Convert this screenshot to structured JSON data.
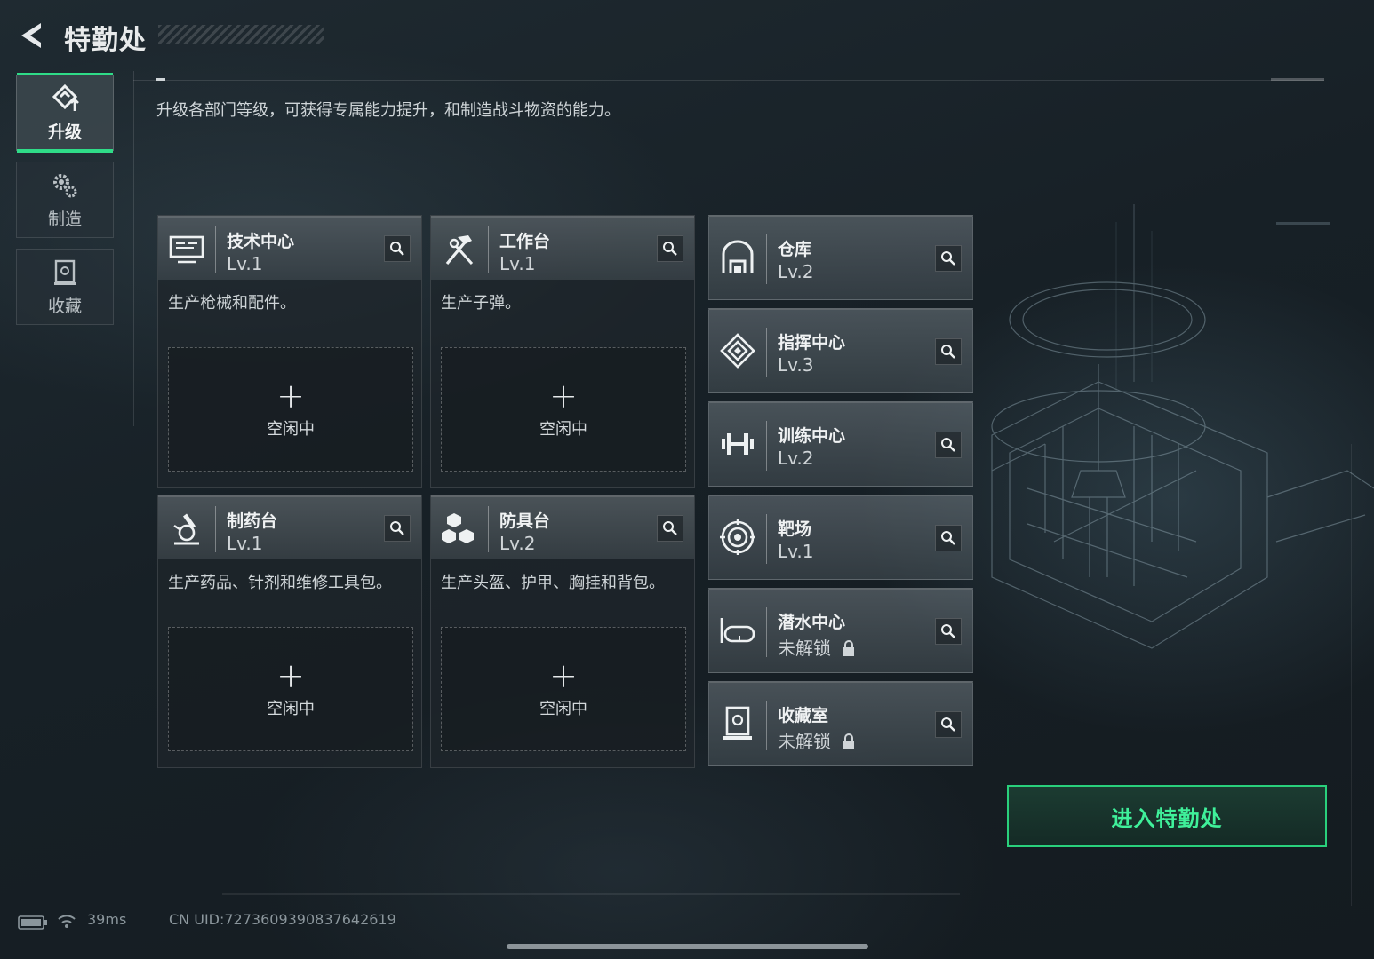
{
  "header": {
    "title": "特勤处"
  },
  "sidebar": {
    "tabs": [
      {
        "label": "升级",
        "icon": "upgrade-icon",
        "active": true
      },
      {
        "label": "制造",
        "icon": "gears-icon",
        "active": false
      },
      {
        "label": "收藏",
        "icon": "collection-icon",
        "active": false
      }
    ]
  },
  "main": {
    "description": "升级各部门等级，可获得专属能力提升，和制造战斗物资的能力。",
    "production_cards": [
      {
        "name": "技术中心",
        "level": "Lv.1",
        "desc": "生产枪械和配件。",
        "slot_label": "空闲中",
        "icon": "monitor-icon"
      },
      {
        "name": "工作台",
        "level": "Lv.1",
        "desc": "生产子弹。",
        "slot_label": "空闲中",
        "icon": "hammer-wrench-icon"
      },
      {
        "name": "制药台",
        "level": "Lv.1",
        "desc": "生产药品、针剂和维修工具包。",
        "slot_label": "空闲中",
        "icon": "microscope-icon"
      },
      {
        "name": "防具台",
        "level": "Lv.2",
        "desc": "生产头盔、护甲、胸挂和背包。",
        "slot_label": "空闲中",
        "icon": "cubes-icon"
      }
    ],
    "facilities": [
      {
        "name": "仓库",
        "level": "Lv.2",
        "icon": "warehouse-icon",
        "locked": false
      },
      {
        "name": "指挥中心",
        "level": "Lv.3",
        "icon": "chip-icon",
        "locked": false
      },
      {
        "name": "训练中心",
        "level": "Lv.2",
        "icon": "dumbbell-icon",
        "locked": false
      },
      {
        "name": "靶场",
        "level": "Lv.1",
        "icon": "target-icon",
        "locked": false
      },
      {
        "name": "潜水中心",
        "level": "未解锁",
        "icon": "diving-mask-icon",
        "locked": true
      },
      {
        "name": "收藏室",
        "level": "未解锁",
        "icon": "display-case-icon",
        "locked": true
      }
    ]
  },
  "enter_button": {
    "label": "进入特勤处"
  },
  "status_bar": {
    "ping": "39ms",
    "uid": "CN UID:7273609390837642619"
  },
  "colors": {
    "accent": "#2fdc88",
    "background": "#172026"
  }
}
